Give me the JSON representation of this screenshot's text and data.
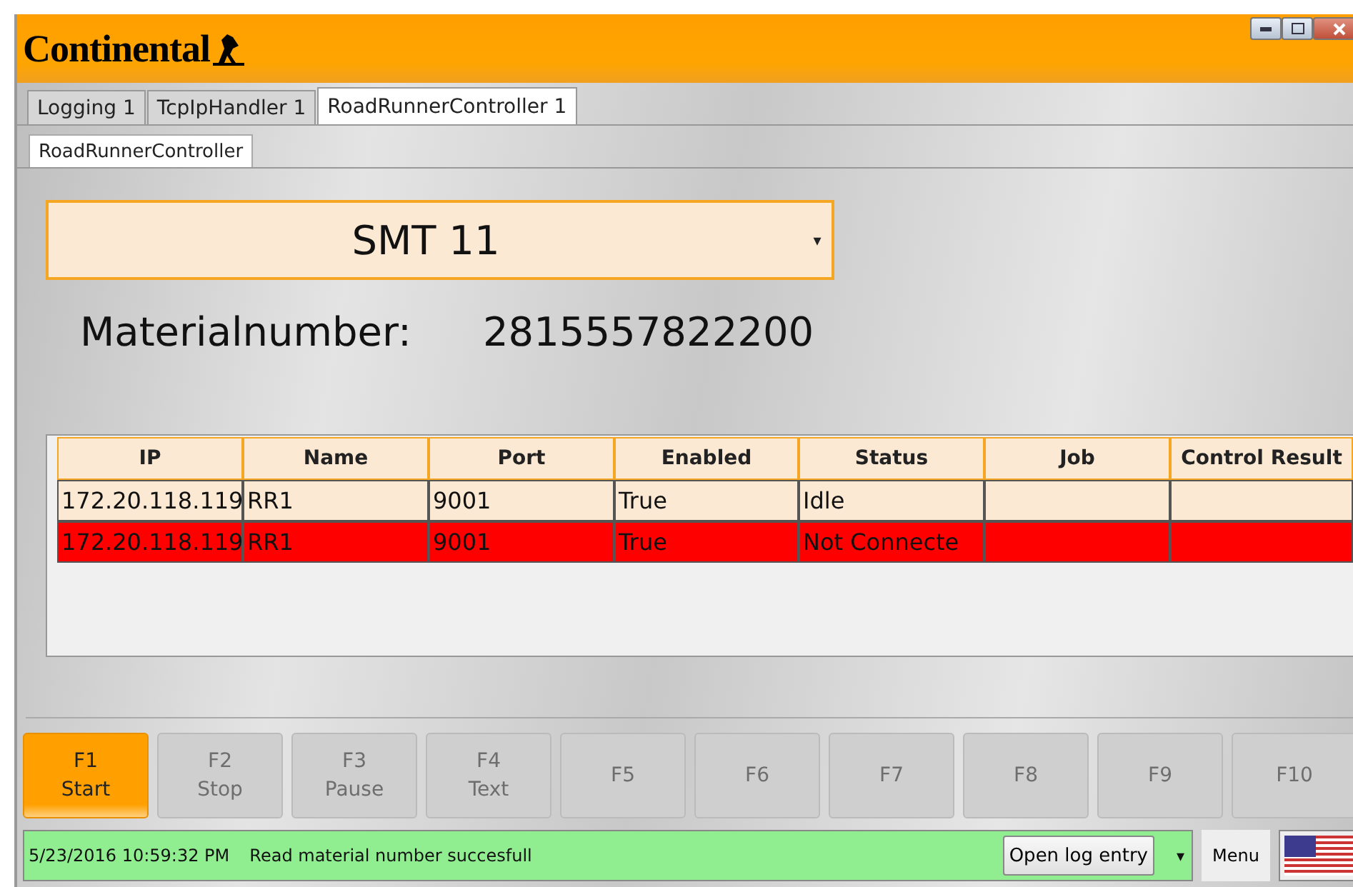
{
  "window": {
    "logo": "Continental"
  },
  "tabs": [
    {
      "label": "Logging 1",
      "selected": false
    },
    {
      "label": "TcpIpHandler 1",
      "selected": false
    },
    {
      "label": "RoadRunnerController 1",
      "selected": true
    }
  ],
  "subtabs": [
    {
      "label": "RoadRunnerController",
      "selected": true
    }
  ],
  "line_select": {
    "value": "SMT 11",
    "arrow": "▾"
  },
  "material": {
    "label": "Materialnumber:",
    "value": "2815557822200"
  },
  "table": {
    "columns": [
      "IP",
      "Name",
      "Port",
      "Enabled",
      "Status",
      "Job",
      "Control Result"
    ],
    "rows": [
      {
        "cells": [
          "172.20.118.119",
          "RR1",
          "9001",
          "True",
          "Idle",
          "",
          ""
        ],
        "error": false
      },
      {
        "cells": [
          "172.20.118.119",
          "RR1",
          "9001",
          "True",
          "Not Connecte",
          "",
          ""
        ],
        "error": true
      }
    ]
  },
  "function_keys": [
    {
      "key": "F1",
      "label": "Start",
      "disabled": false
    },
    {
      "key": "F2",
      "label": "Stop",
      "disabled": true
    },
    {
      "key": "F3",
      "label": "Pause",
      "disabled": true
    },
    {
      "key": "F4",
      "label": "Text",
      "disabled": true
    },
    {
      "key": "F5",
      "disabled": true
    },
    {
      "key": "F6",
      "disabled": true
    },
    {
      "key": "F7",
      "disabled": true
    },
    {
      "key": "F8",
      "disabled": true
    },
    {
      "key": "F9",
      "disabled": true
    },
    {
      "key": "F10",
      "disabled": true
    }
  ],
  "status_bar": {
    "timestamp": "5/23/2016 10:59:32 PM",
    "message": "Read material number succesfull",
    "log_button": "Open log entry",
    "log_arrow": "▾",
    "menu_button": "Menu"
  }
}
